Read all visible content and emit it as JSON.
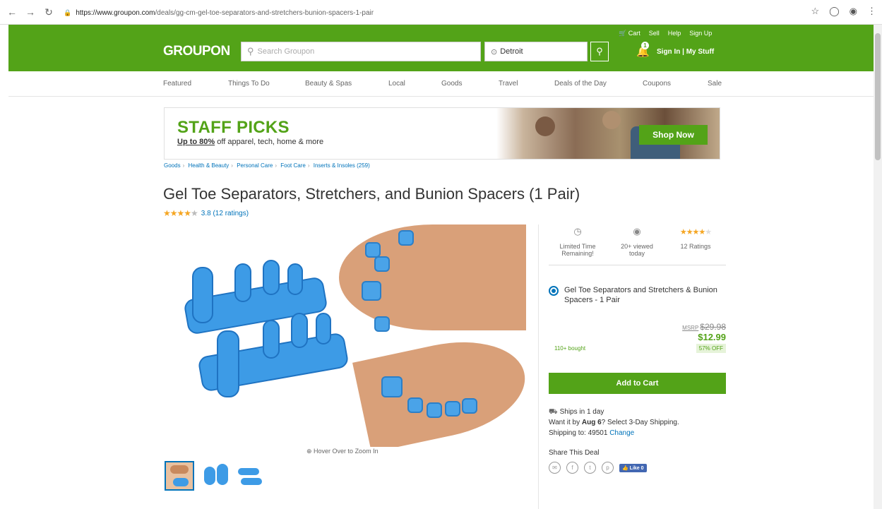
{
  "browser": {
    "url_host": "https://www.groupon.com",
    "url_path": "/deals/gg-cm-gel-toe-separators-and-stretchers-bunion-spacers-1-pair"
  },
  "header": {
    "logo": "GROUPON",
    "search_placeholder": "Search Groupon",
    "location": "Detroit",
    "top_links": [
      "Cart",
      "Sell",
      "Help",
      "Sign Up"
    ],
    "notification_count": "1",
    "sign_in": "Sign In",
    "separator": "|",
    "my_stuff": "My Stuff"
  },
  "nav": {
    "items": [
      "Featured",
      "Things To Do",
      "Beauty & Spas",
      "Local",
      "Goods",
      "Travel",
      "Deals of the Day",
      "Coupons",
      "Sale"
    ]
  },
  "banner": {
    "title": "STAFF PICKS",
    "subtitle_bold": "Up to 80%",
    "subtitle_rest": " off apparel, tech, home & more",
    "button": "Shop Now"
  },
  "breadcrumb": [
    "Goods",
    "Health & Beauty",
    "Personal Care",
    "Foot Care",
    "Inserts & Insoles (259)"
  ],
  "deal": {
    "title": "Gel Toe Separators, Stretchers, and Bunion Spacers (1 Pair)",
    "rating_text": "3.8 (12 ratings)",
    "rating_value": 3.8,
    "zoom_hint": "Hover Over to Zoom In"
  },
  "panel": {
    "stats": [
      {
        "icon": "clock-icon",
        "label_line1": "Limited Time",
        "label_line2": "Remaining!"
      },
      {
        "icon": "eye-icon",
        "label_line1": "20+ viewed",
        "label_line2": "today"
      },
      {
        "icon": "stars-icon",
        "label_line1": "12 Ratings",
        "label_line2": ""
      }
    ],
    "option_text": "Gel Toe Separators and Stretchers & Bunion Spacers - 1 Pair",
    "msrp_label": "MSRP",
    "msrp_value": "$29.98",
    "price": "$12.99",
    "bought": "110+ bought",
    "discount": "57% OFF",
    "add_to_cart": "Add to Cart",
    "ships": "Ships in 1 day",
    "want_prefix": "Want it by ",
    "want_date": "Aug 6",
    "want_suffix": "? Select 3-Day Shipping.",
    "shipping_to": "Shipping to: 49501 ",
    "change": "Change",
    "share_title": "Share This Deal",
    "like": "Like 0"
  },
  "colors": {
    "brand_green": "#53a318",
    "link_blue": "#0073ba",
    "star_gold": "#f5a623"
  }
}
